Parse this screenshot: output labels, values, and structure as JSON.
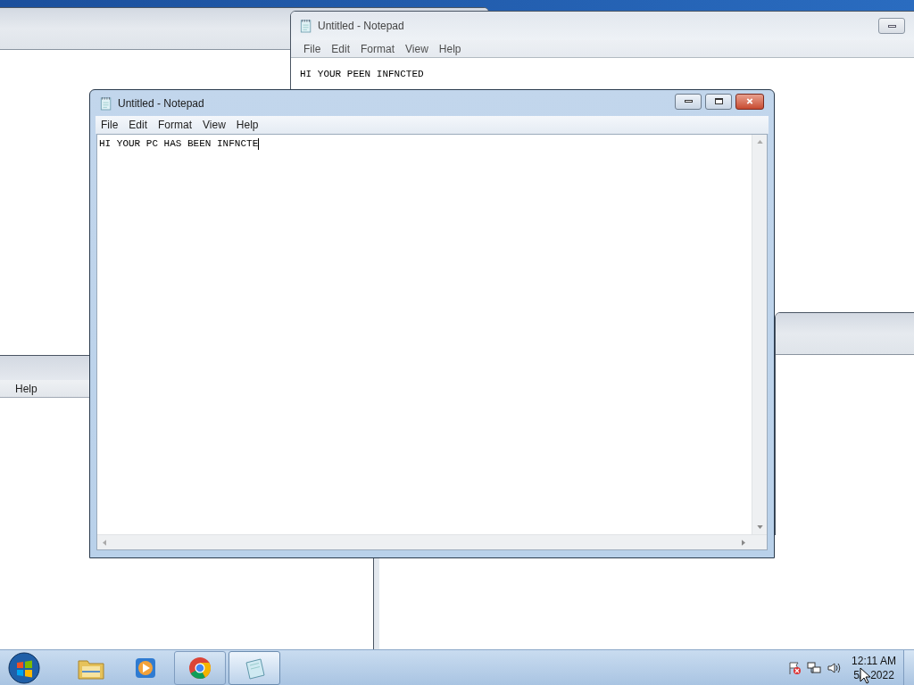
{
  "background_windows": [
    {
      "kind": "plain"
    },
    {
      "kind": "notepad",
      "title": "Untitled - Notepad",
      "menu": [
        "File",
        "Edit",
        "Format",
        "View",
        "Help"
      ],
      "text": "HI YOUR PEEN INFNCTED"
    },
    {
      "kind": "plain"
    },
    {
      "kind": "menu_only",
      "menu": [
        "Help"
      ]
    },
    {
      "kind": "body_only"
    }
  ],
  "active_window": {
    "title": "Untitled - Notepad",
    "menu": [
      "File",
      "Edit",
      "Format",
      "View",
      "Help"
    ],
    "text": "HI YOUR PC HAS BEEN INFNCTE"
  },
  "taskbar": {
    "items": [
      {
        "kind": "explorer",
        "selected": false
      },
      {
        "kind": "media",
        "selected": false
      },
      {
        "kind": "chrome",
        "selected": false
      },
      {
        "kind": "notepad",
        "selected": true
      }
    ],
    "time": "12:11 AM",
    "date_parts": [
      "5/",
      "2022"
    ]
  }
}
